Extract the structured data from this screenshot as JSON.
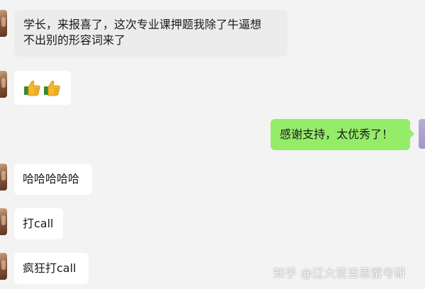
{
  "messages": [
    {
      "side": "left",
      "text": "学长，来报喜了，这次专业课押题我除了牛逼想不出别的形容词来了"
    },
    {
      "side": "left",
      "emoji": [
        "thumbs-up",
        "thumbs-up"
      ]
    },
    {
      "side": "right",
      "text": "感谢支持，太优秀了！"
    },
    {
      "side": "left",
      "text": "哈哈哈哈哈"
    },
    {
      "side": "left",
      "text": "打call"
    },
    {
      "side": "left",
      "text": "疯狂打call"
    }
  ],
  "msg1": {
    "line1": "学长，来报喜了，这次专业课押题我除了牛逼想",
    "line2": "不出别的形容词来了"
  },
  "msg3": {
    "text": "感谢支持，太优秀了！"
  },
  "msg4": {
    "text": "哈哈哈哈哈"
  },
  "msg5": {
    "text": "打call"
  },
  "msg6": {
    "text": "疯狂打call"
  },
  "watermark": {
    "text": "知乎 @辽大亚当思蜜考研"
  },
  "colors": {
    "background": "#f3f3f3",
    "incoming_bubble": "#ffffff",
    "incoming_bubble_gray": "#ececec",
    "outgoing_bubble": "#95ec69"
  }
}
